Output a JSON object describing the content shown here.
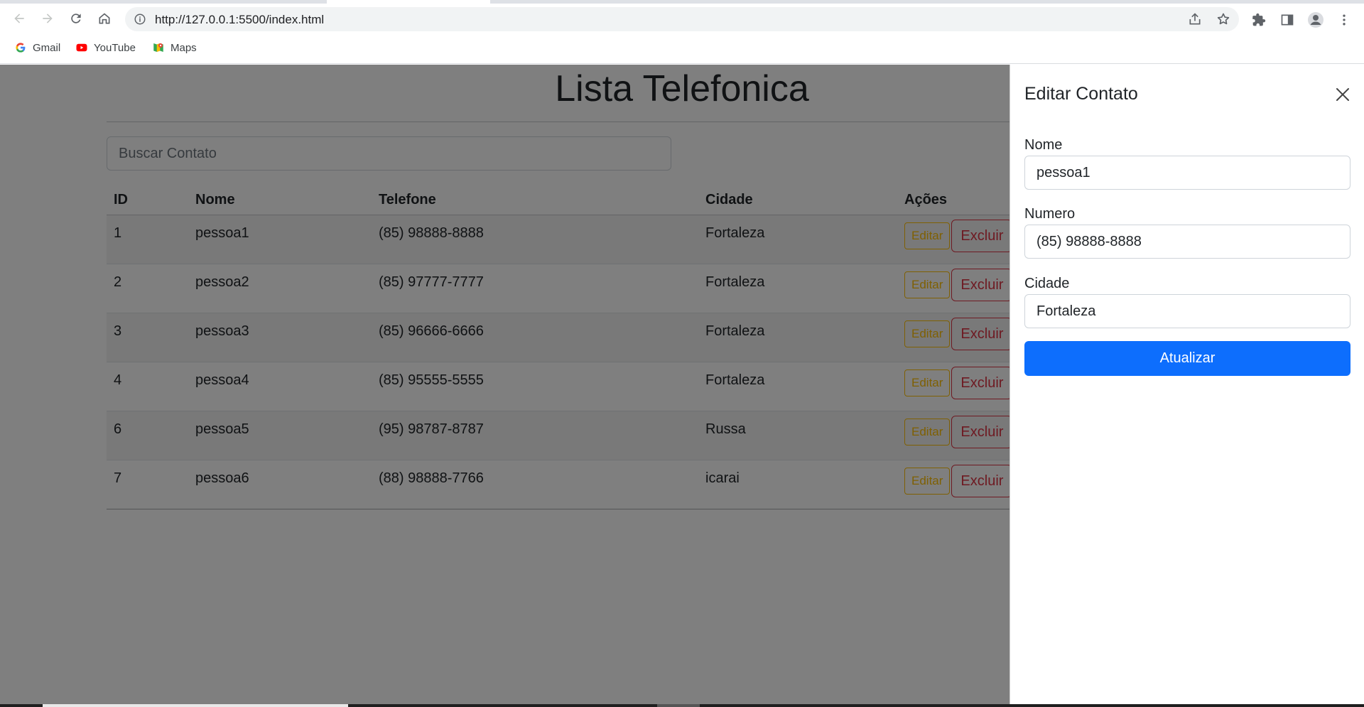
{
  "browser": {
    "url": "http://127.0.0.1:5500/index.html",
    "bookmarks": [
      {
        "label": "Gmail",
        "icon": "gmail-icon"
      },
      {
        "label": "YouTube",
        "icon": "youtube-icon"
      },
      {
        "label": "Maps",
        "icon": "maps-icon"
      }
    ]
  },
  "page": {
    "title": "Lista Telefonica",
    "search_placeholder": "Buscar Contato",
    "table": {
      "headers": [
        "ID",
        "Nome",
        "Telefone",
        "Cidade",
        "Ações"
      ],
      "rows": [
        {
          "id": "1",
          "nome": "pessoa1",
          "telefone": "(85) 98888-8888",
          "cidade": "Fortaleza"
        },
        {
          "id": "2",
          "nome": "pessoa2",
          "telefone": "(85) 97777-7777",
          "cidade": "Fortaleza"
        },
        {
          "id": "3",
          "nome": "pessoa3",
          "telefone": "(85) 96666-6666",
          "cidade": "Fortaleza"
        },
        {
          "id": "4",
          "nome": "pessoa4",
          "telefone": "(85) 95555-5555",
          "cidade": "Fortaleza"
        },
        {
          "id": "6",
          "nome": "pessoa5",
          "telefone": "(95) 98787-8787",
          "cidade": "Russa"
        },
        {
          "id": "7",
          "nome": "pessoa6",
          "telefone": "(88) 98888-7766",
          "cidade": "icarai"
        }
      ],
      "edit_label": "Editar",
      "delete_label": "Excluir"
    }
  },
  "offcanvas": {
    "title": "Editar Contato",
    "fields": {
      "nome": {
        "label": "Nome",
        "value": "pessoa1"
      },
      "numero": {
        "label": "Numero",
        "value": "(85) 98888-8888"
      },
      "cidade": {
        "label": "Cidade",
        "value": "Fortaleza"
      }
    },
    "submit_label": "Atualizar"
  },
  "colors": {
    "primary": "#0d6efd",
    "warning": "#ffc107",
    "danger": "#dc3545"
  }
}
